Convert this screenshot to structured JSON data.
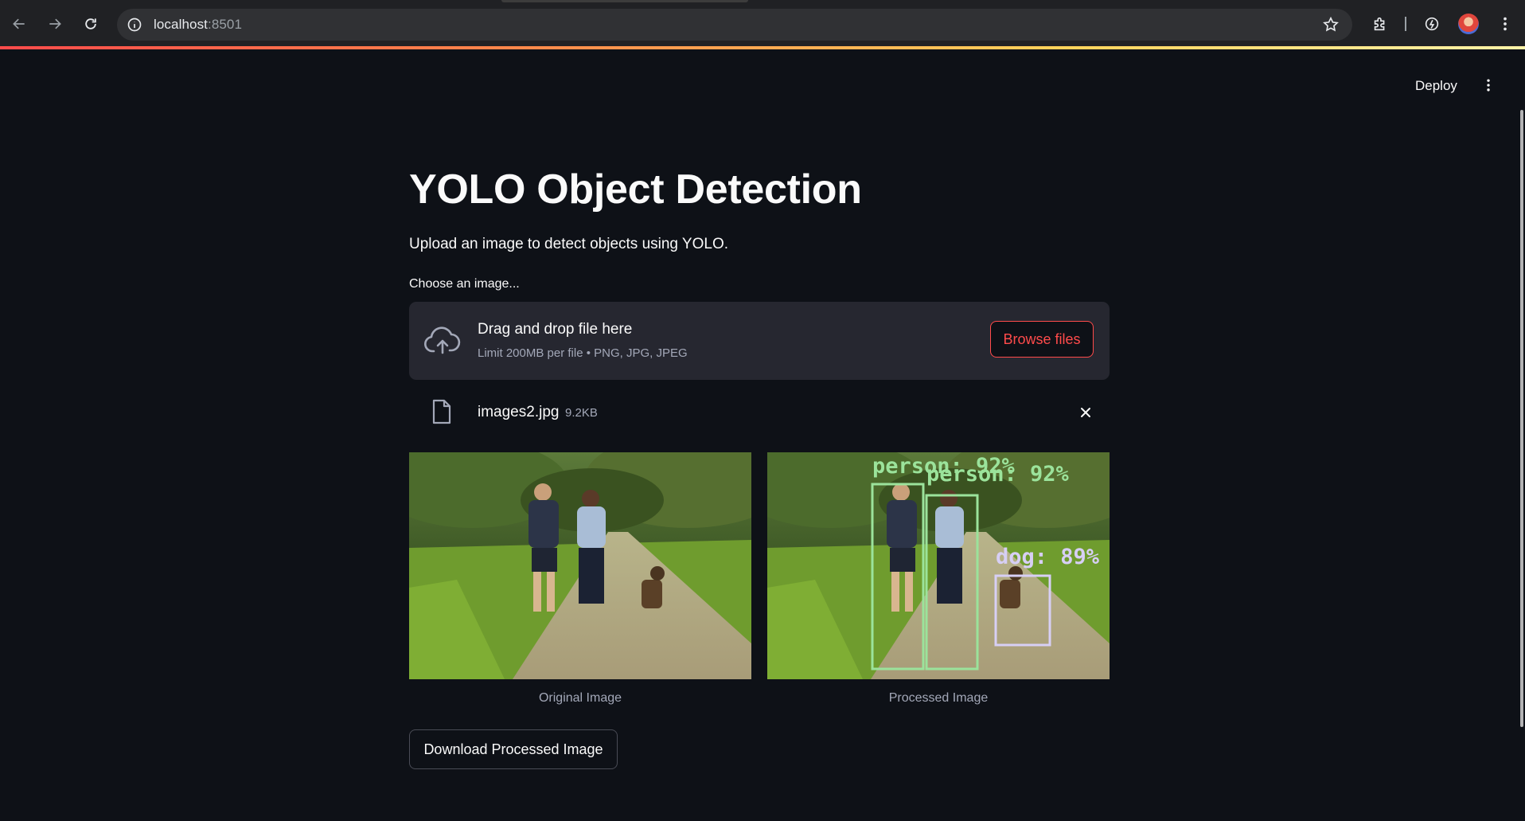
{
  "browser": {
    "url_host": "localhost",
    "url_port": ":8501"
  },
  "header": {
    "deploy_label": "Deploy"
  },
  "main": {
    "title": "YOLO Object Detection",
    "subtitle": "Upload an image to detect objects using YOLO.",
    "uploader": {
      "label": "Choose an image...",
      "drop_title": "Drag and drop file here",
      "drop_hint": "Limit 200MB per file • PNG, JPG, JPEG",
      "browse_label": "Browse files"
    },
    "file": {
      "name": "images2.jpg",
      "size": "9.2KB"
    },
    "images": {
      "original_caption": "Original Image",
      "processed_caption": "Processed Image",
      "detections": [
        {
          "label": "person: 92%"
        },
        {
          "label": "person: 92%"
        },
        {
          "label": "dog: 89%"
        }
      ]
    },
    "download_label": "Download Processed Image"
  },
  "colors": {
    "background": "#0e1117",
    "accent": "#ff4b4b",
    "panel": "#262730",
    "muted_text": "#a3a8b8",
    "person_box": "#9be39b",
    "dog_box": "#d7cff5"
  },
  "icons": [
    "back-icon",
    "forward-icon",
    "reload-icon",
    "info-icon",
    "star-icon",
    "extensions-icon",
    "performance-icon",
    "menu-dots-icon",
    "cloud-upload-icon",
    "file-icon",
    "close-icon"
  ]
}
